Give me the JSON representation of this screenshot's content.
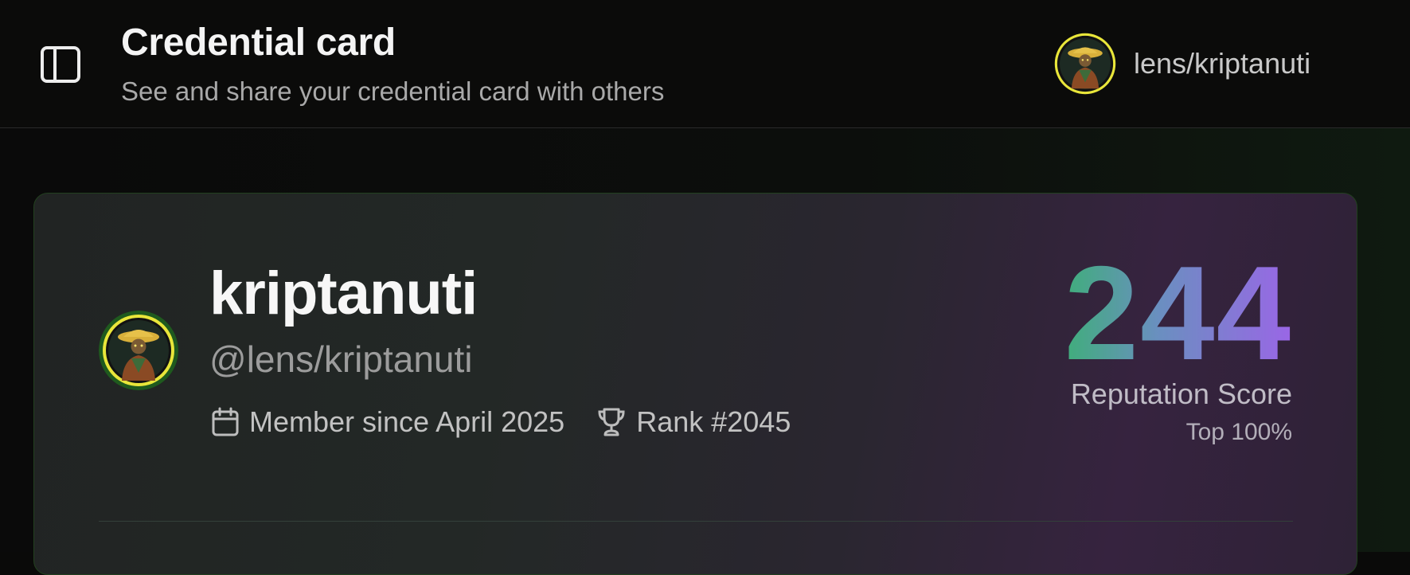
{
  "header": {
    "title": "Credential card",
    "subtitle": "See and share your credential card with others",
    "sidebar_toggle_icon": "sidebar-toggle-icon",
    "user": {
      "username": "lens/kriptanuti",
      "avatar_icon": "avatar"
    }
  },
  "card": {
    "name": "kriptanuti",
    "handle": "@lens/kriptanuti",
    "member_since": "Member since April 2025",
    "member_since_icon": "calendar-icon",
    "rank": "Rank #2045",
    "rank_icon": "trophy-icon",
    "score": "244",
    "score_label": "Reputation Score",
    "score_top": "Top 100%"
  },
  "colors": {
    "score_gradient_start": "#27c45d",
    "score_gradient_end": "#9a66e6",
    "avatar_ring": "#1f5a1e",
    "avatar_ring_inner": "#e8e83a"
  }
}
